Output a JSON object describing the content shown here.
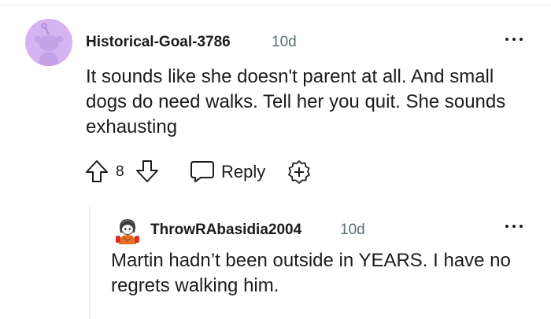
{
  "comment": {
    "author": "Historical-Goal-3786",
    "time": "10d",
    "body": "It sounds like she doesn't parent at all. And small dogs do need walks. Tell her you quit. She sounds exhausting",
    "score": "8",
    "reply_label": "Reply",
    "avatar_color": "#d8b3f2",
    "icons": [
      "upvote-icon",
      "downvote-icon",
      "reply-icon",
      "award-icon",
      "more-options-icon",
      "snoo-avatar-icon"
    ]
  },
  "reply": {
    "author": "ThrowRAbasidia2004",
    "time": "10d",
    "body": "Martin hadn’t been outside in YEARS. I have no regrets walking him.",
    "icons": [
      "more-options-icon",
      "custom-avatar-icon"
    ]
  }
}
